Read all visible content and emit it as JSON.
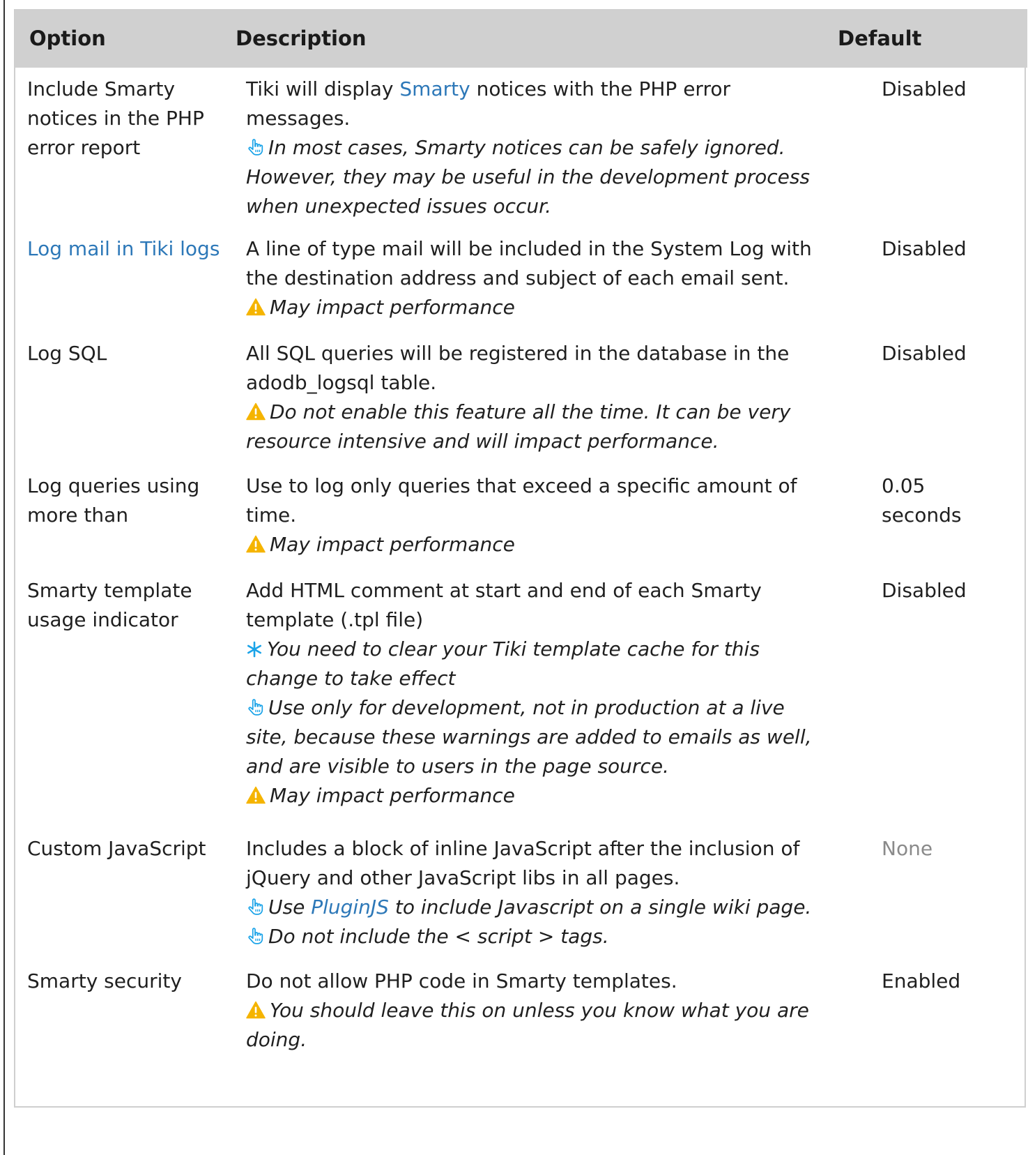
{
  "headers": {
    "option": "Option",
    "description": "Description",
    "default": "Default"
  },
  "rows": [
    {
      "option": "Include Smarty notices in the PHP error report",
      "desc_pre": "Tiki will display ",
      "desc_link": "Smarty",
      "desc_post": " notices with the PHP error messages.",
      "tip": "In most cases, Smarty notices can be safely ignored. However, they may be useful in the development process when unexpected issues occur.",
      "default": "Disabled"
    },
    {
      "option": "Log mail in Tiki logs",
      "desc": "A line of type mail will be included in the System Log with the destination address and subject of each email sent.",
      "warning": "May impact performance",
      "default": "Disabled"
    },
    {
      "option": "Log SQL",
      "desc": "All SQL queries will be registered in the database in the adodb_logsql table.",
      "warning": "Do not enable this feature all the time. It can be very resource intensive and will impact performance.",
      "default": "Disabled"
    },
    {
      "option": "Log queries using more than",
      "desc": "Use to log only queries that exceed a specific amount of time.",
      "warning": "May impact performance",
      "default": "0.05 seconds"
    },
    {
      "option": "Smarty template usage indicator",
      "desc": "Add HTML comment at start and end of each Smarty template (.tpl file)",
      "note": "You need to clear your Tiki template cache for this change to take effect",
      "tip": "Use only for development, not in production at a live site, because these warnings are added to emails as well, and are visible to users in the page source.",
      "warning": "May impact performance",
      "default": "Disabled"
    },
    {
      "option": "Custom JavaScript",
      "desc": "Includes a block of inline JavaScript after the inclusion of jQuery and other JavaScript libs in all pages.",
      "tip1_pre": "Use ",
      "tip1_link": "PluginJS",
      "tip1_post": " to include Javascript on a single wiki page.",
      "tip2": "Do not include the < script > tags.",
      "default": "None"
    },
    {
      "option": "Smarty security",
      "desc": "Do not allow PHP code in Smarty templates.",
      "warning": "You should leave this on unless you know what you are doing.",
      "default": "Enabled"
    }
  ],
  "colors": {
    "link": "#2d78b8",
    "header_bg": "#d0d0d0",
    "warning": "#f5b400",
    "note_asterisk": "#1aa3e8",
    "tip_icon": "#1aa3e8"
  },
  "icons": {
    "tip": "hand-pointer-icon",
    "warning": "warning-triangle-icon",
    "note": "asterisk-icon"
  }
}
